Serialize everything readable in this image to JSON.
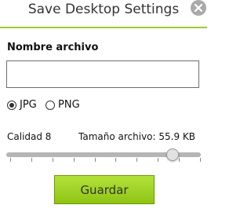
{
  "dialog": {
    "title": "Save Desktop Settings"
  },
  "filename": {
    "label": "Nombre archivo",
    "value": "",
    "placeholder": ""
  },
  "format": {
    "options": [
      {
        "label": "JPG",
        "selected": true
      },
      {
        "label": "PNG",
        "selected": false
      }
    ]
  },
  "quality": {
    "label": "Calidad 8",
    "value": 8,
    "min": 1,
    "max": 10
  },
  "file_size": {
    "label": "Tamaño archivo: 55.9 KB"
  },
  "actions": {
    "save_label": "Guardar"
  },
  "colors": {
    "accent": "#9acd32",
    "button": "#9fd12a"
  }
}
